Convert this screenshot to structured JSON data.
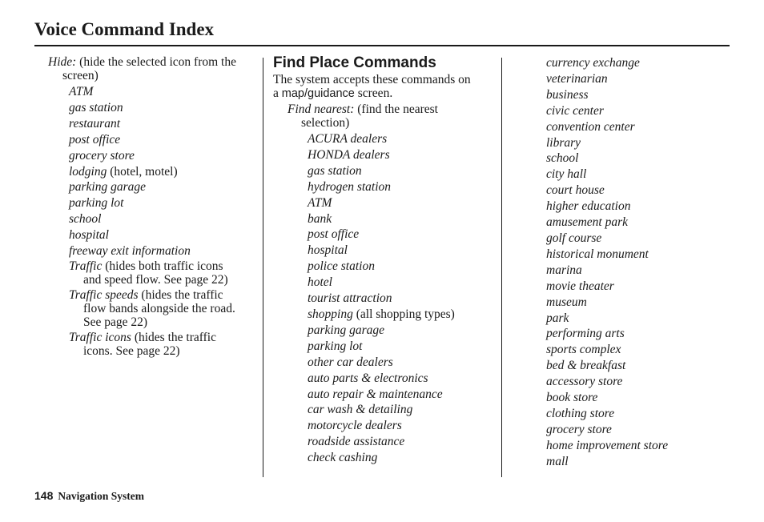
{
  "header": {
    "title": "Voice Command Index"
  },
  "column1": {
    "hide_entry": {
      "command": "Hide:",
      "description": " (hide the selected icon from the",
      "description_cont": "screen)"
    },
    "hide_items": [
      {
        "text": "ATM",
        "note": ""
      },
      {
        "text": "gas station",
        "note": ""
      },
      {
        "text": "restaurant",
        "note": ""
      },
      {
        "text": "post office",
        "note": ""
      },
      {
        "text": "grocery store",
        "note": ""
      },
      {
        "text": "lodging",
        "note": " (hotel, motel)"
      },
      {
        "text": "parking garage",
        "note": ""
      },
      {
        "text": "parking lot",
        "note": ""
      },
      {
        "text": "school",
        "note": ""
      },
      {
        "text": "hospital",
        "note": ""
      },
      {
        "text": "freeway exit information",
        "note": ""
      }
    ],
    "traffic_items": [
      {
        "text": "Traffic",
        "line1": " (hides both traffic icons",
        "line2": "and speed flow. See page 22)",
        "line3": ""
      },
      {
        "text": "Traffic speeds",
        "line1": " (hides the traffic",
        "line2": "flow bands alongside the road.",
        "line3": "See page 22)"
      },
      {
        "text": "Traffic icons",
        "line1": " (hides the traffic",
        "line2": "icons. See page 22)",
        "line3": ""
      }
    ]
  },
  "column2": {
    "heading": "Find Place Commands",
    "intro_line1": "The system accepts these commands on",
    "intro_a": "a ",
    "intro_screen_name": "map/guidance",
    "intro_end": " screen.",
    "find_entry": {
      "command": "Find nearest:",
      "description": " (find the nearest",
      "description_cont": "selection)"
    },
    "items": [
      {
        "text": "ACURA dealers",
        "note": ""
      },
      {
        "text": "HONDA dealers",
        "note": ""
      },
      {
        "text": "gas station",
        "note": ""
      },
      {
        "text": "hydrogen station",
        "note": ""
      },
      {
        "text": "ATM",
        "note": ""
      },
      {
        "text": "bank",
        "note": ""
      },
      {
        "text": "post office",
        "note": ""
      },
      {
        "text": "hospital",
        "note": ""
      },
      {
        "text": "police station",
        "note": ""
      },
      {
        "text": "hotel",
        "note": ""
      },
      {
        "text": "tourist attraction",
        "note": ""
      },
      {
        "text": "shopping",
        "note": " (all shopping types)"
      },
      {
        "text": "parking garage",
        "note": ""
      },
      {
        "text": "parking lot",
        "note": ""
      },
      {
        "text": "other car dealers",
        "note": ""
      },
      {
        "text": "auto parts & electronics",
        "note": ""
      },
      {
        "text": "auto repair & maintenance",
        "note": ""
      },
      {
        "text": "car wash & detailing",
        "note": ""
      },
      {
        "text": "motorcycle dealers",
        "note": ""
      },
      {
        "text": "roadside assistance",
        "note": ""
      },
      {
        "text": "check cashing",
        "note": ""
      }
    ]
  },
  "column3": {
    "items": [
      "currency exchange",
      "veterinarian",
      "business",
      "civic center",
      "convention center",
      "library",
      "school",
      "city hall",
      "court house",
      "higher education",
      "amusement park",
      "golf course",
      "historical monument",
      "marina",
      "movie theater",
      "museum",
      "park",
      "performing arts",
      "sports complex",
      "bed & breakfast",
      "accessory store",
      "book store",
      "clothing store",
      "grocery store",
      "home improvement store",
      "mall"
    ]
  },
  "footer": {
    "page_number": "148",
    "section": "Navigation System"
  }
}
